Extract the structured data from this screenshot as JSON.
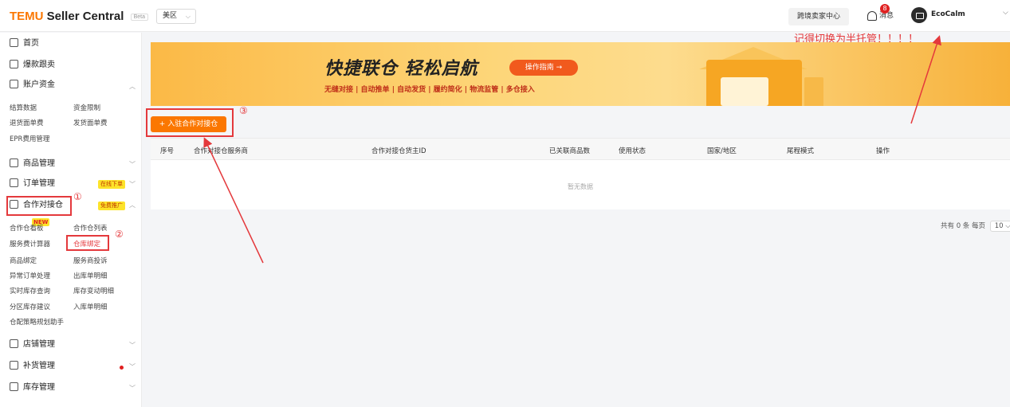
{
  "header": {
    "logo_brand": "TEMU",
    "logo_rest": "Seller Central",
    "logo_badge": "Beta",
    "region": "美区",
    "cross_border_center": "跨境卖家中心",
    "messages_label": "消息",
    "messages_badge": "8",
    "user_name": "EcoCalm",
    "accent_color": "#fb7701"
  },
  "annotations": {
    "top_note": "记得切换为半托管！！！！",
    "mark_1": "①",
    "mark_2": "②",
    "mark_3": "③",
    "mark_color": "#e4393c"
  },
  "sidebar": {
    "home": "首页",
    "hot_follow": "爆款跟卖",
    "account_funds": "账户资金",
    "account_subs": [
      "结算数据",
      "资金限制",
      "退货面单费",
      "发货面单费",
      "EPR费用管理"
    ],
    "product_mgmt": "商品管理",
    "order_mgmt": "订单管理",
    "order_tag": "在线下单",
    "coop_warehouse": "合作对接仓",
    "coop_tag": "免费推广",
    "new_tag": "NEW",
    "coop_subs": [
      "合作仓看板",
      "合作仓列表",
      "服务费计算器",
      "仓库绑定",
      "商品绑定",
      "服务商投诉",
      "异常订单处理",
      "出库单明细",
      "实时库存查询",
      "库存变动明细",
      "分区库存建议",
      "入库单明细",
      "仓配策略规划助手"
    ],
    "shop_mgmt": "店铺管理",
    "restock_mgmt": "补货管理",
    "inventory_mgmt": "库存管理"
  },
  "banner": {
    "title": "快捷联仓 轻松启航",
    "guide_button": "操作指南 →",
    "features": "无缝对接 | 自动推单 | 自动发货 | 履约简化 | 物流监管 | 多仓接入"
  },
  "main": {
    "add_button": "+ 入驻合作对接仓",
    "columns": [
      "序号",
      "合作对接仓服务商",
      "合作对接仓货主ID",
      "已关联商品数",
      "使用状态",
      "国家/地区",
      "尾程模式",
      "操作"
    ],
    "empty_text": "暂无数据",
    "pager_total": "共有 0 条  每页",
    "pager_size": "10"
  }
}
